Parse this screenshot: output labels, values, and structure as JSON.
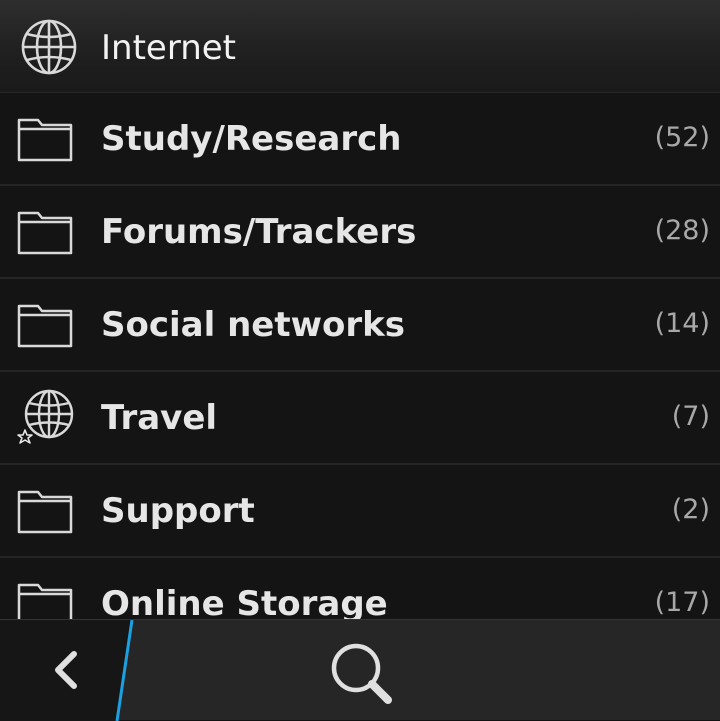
{
  "header": {
    "title": "Internet",
    "icon": "globe-icon"
  },
  "items": [
    {
      "label": "Study/Research",
      "count": "(52)",
      "icon": "folder-icon"
    },
    {
      "label": "Forums/Trackers",
      "count": "(28)",
      "icon": "folder-icon"
    },
    {
      "label": "Social networks",
      "count": "(14)",
      "icon": "folder-icon"
    },
    {
      "label": "Travel",
      "count": "(7)",
      "icon": "globe-star-icon"
    },
    {
      "label": "Support",
      "count": "(2)",
      "icon": "folder-icon"
    },
    {
      "label": "Online Storage",
      "count": "(17)",
      "icon": "folder-icon"
    }
  ],
  "bottombar": {
    "back_icon": "chevron-left-icon",
    "search_icon": "search-icon",
    "accent_color": "#1ba1e2"
  }
}
